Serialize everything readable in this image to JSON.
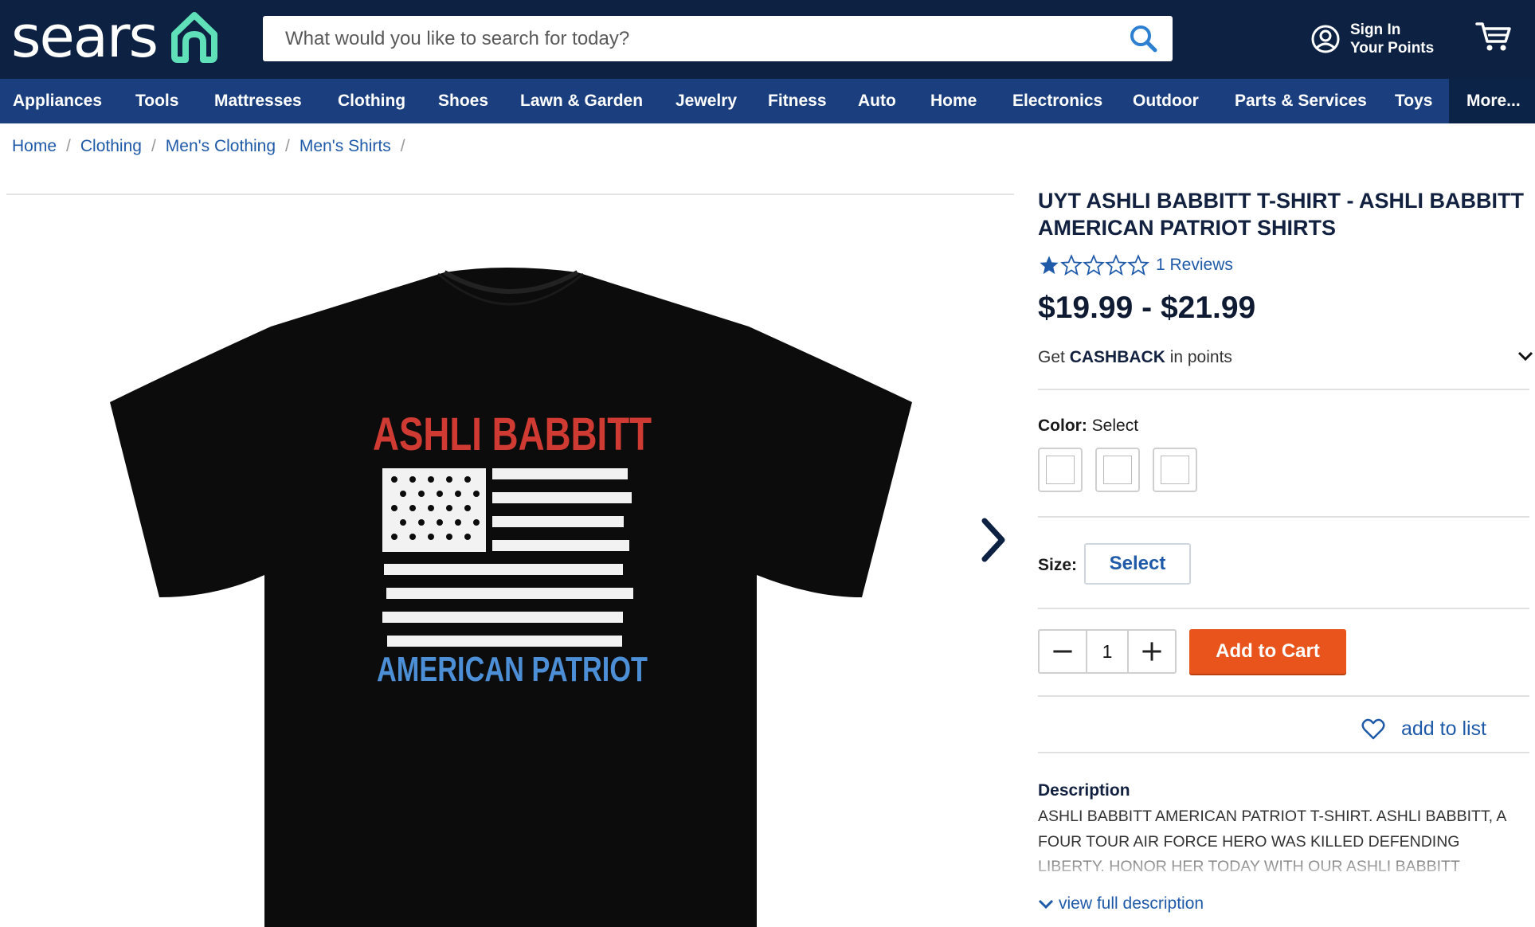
{
  "header": {
    "logo_text": "sears",
    "search_placeholder": "What would you like to search for today?",
    "account_line1": "Sign In",
    "account_line2": "Your Points"
  },
  "nav": {
    "items": [
      "Appliances",
      "Tools",
      "Mattresses",
      "Clothing",
      "Shoes",
      "Lawn & Garden",
      "Jewelry",
      "Fitness",
      "Auto",
      "Home",
      "Electronics",
      "Outdoor",
      "Parts & Services",
      "Toys"
    ],
    "more_label": "More..."
  },
  "breadcrumb": [
    "Home",
    "Clothing",
    "Men's Clothing",
    "Men's Shirts"
  ],
  "product": {
    "title_line1": "UYT ASHLI BABBITT T-SHIRT - ASHLI BABBITT",
    "title_line2": "AMERICAN PATRIOT SHIRTS",
    "rating": 1,
    "rating_max": 5,
    "reviews_label": "1 Reviews",
    "price": "$19.99 - $21.99",
    "cashback_prefix": "Get ",
    "cashback_bold": "CASHBACK",
    "cashback_suffix": " in points",
    "color_label": "Color:",
    "color_value": "Select",
    "size_label": "Size:",
    "size_value": "Select",
    "quantity": "1",
    "add_to_cart": "Add to Cart",
    "add_to_list": "add to list",
    "description_title": "Description",
    "description_text": "ASHLI BABBITT AMERICAN PATRIOT T-SHIRT. ASHLI BABBITT, A FOUR TOUR AIR FORCE HERO WAS KILLED DEFENDING LIBERTY. HONOR HER TODAY WITH OUR ASHLI BABBITT AMERICAN...",
    "view_full": "view full description"
  },
  "shirt_print": {
    "top_text": "ASHLI BABBITT",
    "bottom_text": "AMERICAN PATRIOT"
  },
  "colors": {
    "header_bg": "#0d2142",
    "nav_bg": "#1a3e7e",
    "accent_link": "#1f5aa8",
    "cart_button": "#e8541c",
    "logo_house": "#5fe0b8"
  }
}
